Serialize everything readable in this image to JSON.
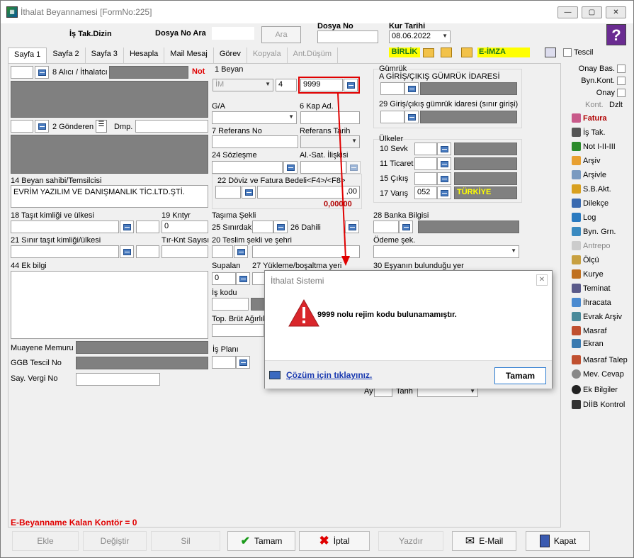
{
  "window": {
    "title": "İthalat Beyannamesi [FormNo:225]",
    "min": "—",
    "max": "▢",
    "close": "✕"
  },
  "header": {
    "is_tak_dizin": "İş Tak.Dizin",
    "dosya_no_ara": "Dosya No Ara",
    "ara_btn": "Ara",
    "dosya_no_label": "Dosya No",
    "kur_tarihi_label": "Kur Tarihi",
    "kur_tarihi_value": "08.06.2022",
    "help": "?"
  },
  "tabs": [
    "Sayfa 1",
    "Sayfa 2",
    "Sayfa 3",
    "Hesapla",
    "Mail Mesaj",
    "Görev",
    "Kopyala",
    "Ant.Düşüm"
  ],
  "toolbar": {
    "birlik": "BİRLİK",
    "eimza": "E-İMZA",
    "tescil": "Tescil"
  },
  "left": {
    "alici": "8 Alıcı / İthalatcı",
    "not": "Not",
    "gonderen": "2 Gönderen",
    "dmp": "Dmp.",
    "beyan_sahibi": "14 Beyan sahibi/Temsilcisi",
    "beyan_sahibi_value": "EVRİM YAZILIM VE DANIŞMANLIK TİC.LTD.ŞTİ.",
    "tasit": "18 Taşıt kimliği ve ülkesi",
    "kntyr": "19 Kntyr",
    "kntyr_value": "0",
    "sinir_tasit": "21 Sınır taşıt kimliği/ülkesi",
    "tir_knt": "Tır-Knt Sayısı",
    "ek_bilgi": "44 Ek bilgi",
    "muayene": "Muayene Memuru",
    "ggb": "GGB Tescil No",
    "vergi": "Say. Vergi No"
  },
  "mid": {
    "beyan": "1 Beyan",
    "beyan_type": "İM",
    "beyan_num": "4",
    "rejim": "9999",
    "ga": "G/A",
    "kap_ad": "6 Kap Ad.",
    "referans": "7 Referans No",
    "ref_tarih": "Referans Tarih",
    "sozlesme": "24 Sözleşme",
    "al_sat": "Al.-Sat. İlişkisi",
    "doviz": "22 Döviz ve Fatura Bedeli<F4>/<F8>",
    "doviz_val1": ",00",
    "doviz_val2": "0,00000",
    "tasima": "Taşıma Şekli",
    "sinirdaki": "25 Sınırdaki",
    "dahili": "26 Dahili",
    "teslim": "20 Teslim şekli ve şehri",
    "supalan": "Supalan",
    "supalan_value": "0",
    "yukleme": "27 Yükleme/boşaltma yeri",
    "is_kodu": "İş kodu",
    "top_brut": "Top. Brüt Ağırlık",
    "is_plani": "İş Planı",
    "ay": "Ay",
    "tarih": "Tarih"
  },
  "right": {
    "gumruk": "Gümrük",
    "giris_cikis": "A GİRİŞ/ÇIKIŞ GÜMRÜK İDARESİ",
    "giris_sinir": "29 Giriş/çıkış gümrük idaresi (sınır girişi)",
    "ulkeler": "Ülkeler",
    "sevk": "10 Sevk",
    "ticaret": "11 Ticaret",
    "cikis": "15 Çıkış",
    "varis": "17 Varış",
    "varis_code": "052",
    "varis_name": "TÜRKİYE",
    "banka": "28 Banka Bilgisi",
    "odeme": "Ödeme şek.",
    "esya": "30 Eşyanın bulunduğu yer"
  },
  "sidepanel": {
    "onay_bas": "Onay Bas.",
    "byn_kont": "Byn.Kont.",
    "onay": "Onay",
    "kont": "Kont.",
    "dzlt": "Dzlt",
    "items": [
      "Fatura",
      "İş Tak.",
      "Not I-II-III",
      "Arşiv",
      "Arşivle",
      "S.B.Akt.",
      "Dilekçe",
      "Log",
      "Byn. Grn.",
      "Antrepo",
      "Ölçü",
      "Kurye",
      "Teminat",
      "İhracata",
      "Evrak Arşiv",
      "Masraf",
      "Ekran",
      "Masraf Talep",
      "Mev. Cevap",
      "Ek Bilgiler",
      "DİİB Kontrol"
    ]
  },
  "footer": {
    "kontor": "E-Beyanname Kalan Kontör = 0",
    "ekle": "Ekle",
    "degistir": "Değiştir",
    "sil": "Sil",
    "tamam": "Tamam",
    "iptal": "İptal",
    "yazdir": "Yazdır",
    "email": "E-Mail",
    "kapat": "Kapat"
  },
  "dialog": {
    "title": "İthalat Sistemi",
    "message": "9999 nolu rejim kodu bulunamamıştır.",
    "link": "Çözüm için tıklayınız.",
    "ok": "Tamam"
  },
  "colors": {
    "accent": "#e00000",
    "gray_field": "#808080",
    "yellow": "#ffff00",
    "green_bg": "#808080"
  }
}
